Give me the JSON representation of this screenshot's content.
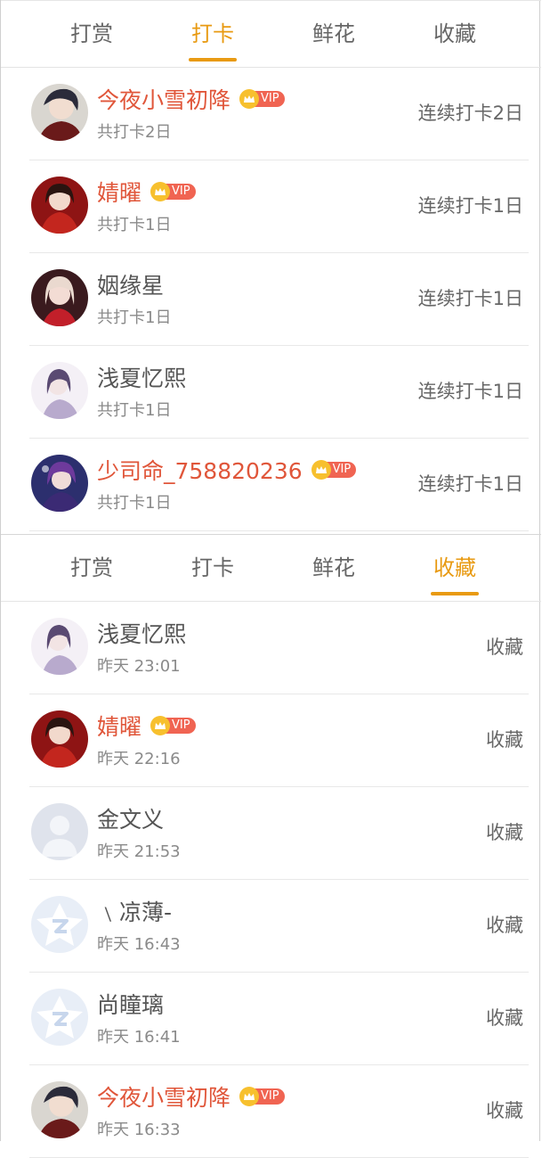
{
  "tabs": [
    "打赏",
    "打卡",
    "鲜花",
    "收藏"
  ],
  "panel1": {
    "active_tab": 1,
    "rows": [
      {
        "name": "今夜小雪初降",
        "vip": true,
        "sub": "共打卡2日",
        "right": "连续打卡2日",
        "avatar": "avatar-dark-hair-man"
      },
      {
        "name": "婧曜",
        "vip": true,
        "sub": "共打卡1日",
        "right": "连续打卡1日",
        "avatar": "avatar-red-dress-woman"
      },
      {
        "name": "姻缘星",
        "vip": false,
        "sub": "共打卡1日",
        "right": "连续打卡1日",
        "avatar": "avatar-white-hair-woman"
      },
      {
        "name": "浅夏忆熙",
        "vip": false,
        "sub": "共打卡1日",
        "right": "连续打卡1日",
        "avatar": "avatar-lavender-woman"
      },
      {
        "name": "少司命_758820236",
        "vip": true,
        "sub": "共打卡1日",
        "right": "连续打卡1日",
        "avatar": "avatar-purple-warrior"
      }
    ]
  },
  "panel2": {
    "active_tab": 3,
    "rows": [
      {
        "name": "浅夏忆熙",
        "vip": false,
        "sub": "昨天 23:01",
        "right": "收藏",
        "avatar": "avatar-lavender-woman"
      },
      {
        "name": "婧曜",
        "vip": true,
        "sub": "昨天 22:16",
        "right": "收藏",
        "avatar": "avatar-red-dress-woman"
      },
      {
        "name": "金文义",
        "vip": false,
        "sub": "昨天 21:53",
        "right": "收藏",
        "avatar": "default-user-icon"
      },
      {
        "name": "﹨凉薄-",
        "vip": false,
        "sub": "昨天 16:43",
        "right": "收藏",
        "avatar": "qq-logo-icon"
      },
      {
        "name": "尚瞳璃",
        "vip": false,
        "sub": "昨天 16:41",
        "right": "收藏",
        "avatar": "qq-logo-icon"
      },
      {
        "name": "今夜小雪初降",
        "vip": true,
        "sub": "昨天 16:33",
        "right": "收藏",
        "avatar": "avatar-dark-hair-man"
      }
    ]
  },
  "vip_label": "VIP",
  "colors": {
    "accent": "#e89a12",
    "vip_name": "#e0563a",
    "vip_badge": "#f06452",
    "crown": "#f7c02e"
  }
}
